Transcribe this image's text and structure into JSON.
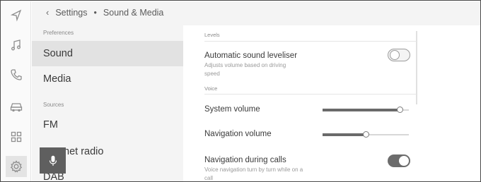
{
  "header": {
    "back_icon": "chevron-left-icon",
    "crumb_root": "Settings",
    "separator": "•",
    "crumb_current": "Sound & Media"
  },
  "rail": {
    "items": [
      {
        "icon": "navigation-arrow-icon"
      },
      {
        "icon": "music-note-icon"
      },
      {
        "icon": "phone-icon"
      },
      {
        "icon": "car-icon"
      },
      {
        "icon": "apps-grid-icon"
      },
      {
        "icon": "gear-icon",
        "selected": true
      }
    ]
  },
  "list": {
    "preferences_label": "Preferences",
    "preferences_items": [
      "Sound",
      "Media"
    ],
    "sources_label": "Sources",
    "sources_items": [
      "FM",
      "Internet radio",
      "DAB"
    ],
    "active_item": "Sound"
  },
  "voice_button": {
    "icon": "microphone-icon"
  },
  "detail": {
    "levels_label": "Levels",
    "leveliser": {
      "title": "Automatic sound leveliser",
      "desc": "Adjusts volume based on driving speed",
      "on": false
    },
    "voice_label": "Voice",
    "system_volume": {
      "title": "System volume",
      "level": 0.89
    },
    "navigation_volume": {
      "title": "Navigation volume",
      "level": 0.5
    },
    "nav_during_calls": {
      "title": "Navigation during calls",
      "desc": "Voice navigation turn by turn while on a call",
      "on": true
    }
  },
  "colors": {
    "accent": "#6c6c6c",
    "panel_bg": "#f4f4f4",
    "active_bg": "#e2e2e2",
    "mic_bg": "#5f5f5f"
  }
}
